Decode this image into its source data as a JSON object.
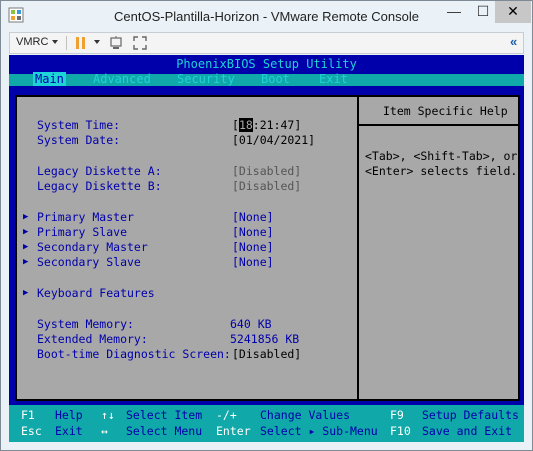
{
  "window": {
    "title": "CentOS-Plantilla-Horizon - VMware Remote Console",
    "min_glyph": "—",
    "max_glyph": "☐",
    "close_glyph": "✕"
  },
  "toolbar": {
    "vmrc_label": "VMRC",
    "collapse_glyph": "«",
    "icons": [
      "vmrc-menu",
      "pause",
      "send-keys",
      "fullscreen"
    ]
  },
  "bios": {
    "title": "PhoenixBIOS Setup Utility",
    "menu": [
      "Main",
      "Advanced",
      "Security",
      "Boot",
      "Exit"
    ],
    "active_menu": "Main",
    "help_title": "Item Specific Help",
    "help_text_1": "<Tab>, <Shift-Tab>, or",
    "help_text_2": "<Enter> selects field.",
    "system_time": {
      "label": "System Time:",
      "cursor": "18",
      "rest": ":21:47]",
      "open": "["
    },
    "system_date": {
      "label": "System Date:",
      "value": "[01/04/2021]"
    },
    "legacy_a": {
      "label": "Legacy Diskette A:",
      "value": "[Disabled]"
    },
    "legacy_b": {
      "label": "Legacy Diskette B:",
      "value": "[Disabled]"
    },
    "submenus": [
      {
        "label": "Primary Master",
        "value": "[None]"
      },
      {
        "label": "Primary Slave",
        "value": "[None]"
      },
      {
        "label": "Secondary Master",
        "value": "[None]"
      },
      {
        "label": "Secondary Slave",
        "value": "[None]"
      }
    ],
    "keyboard": {
      "label": "Keyboard Features"
    },
    "system_memory": {
      "label": "System Memory:",
      "value": "640 KB"
    },
    "extended_memory": {
      "label": "Extended Memory:",
      "value": "5241856 KB"
    },
    "boot_diag": {
      "label": "Boot-time Diagnostic Screen:",
      "value": "[Disabled]"
    }
  },
  "footer": {
    "row1": [
      {
        "key": "F1",
        "desc": "Help"
      },
      {
        "key": "↑↓",
        "desc": "Select Item"
      },
      {
        "key": "-/+",
        "desc": "Change Values"
      },
      {
        "key": "F9",
        "desc": "Setup Defaults"
      }
    ],
    "row2": [
      {
        "key": "Esc",
        "desc": "Exit"
      },
      {
        "key": "↔",
        "desc": "Select Menu"
      },
      {
        "key": "Enter",
        "desc": "Select ▸ Sub-Menu"
      },
      {
        "key": "F10",
        "desc": "Save and Exit"
      }
    ]
  },
  "colors": {
    "bios_blue": "#0000aa",
    "bios_cyan": "#1ed3d8",
    "bios_grey": "#a8a8a8",
    "footer_teal": "#10a8a8"
  }
}
